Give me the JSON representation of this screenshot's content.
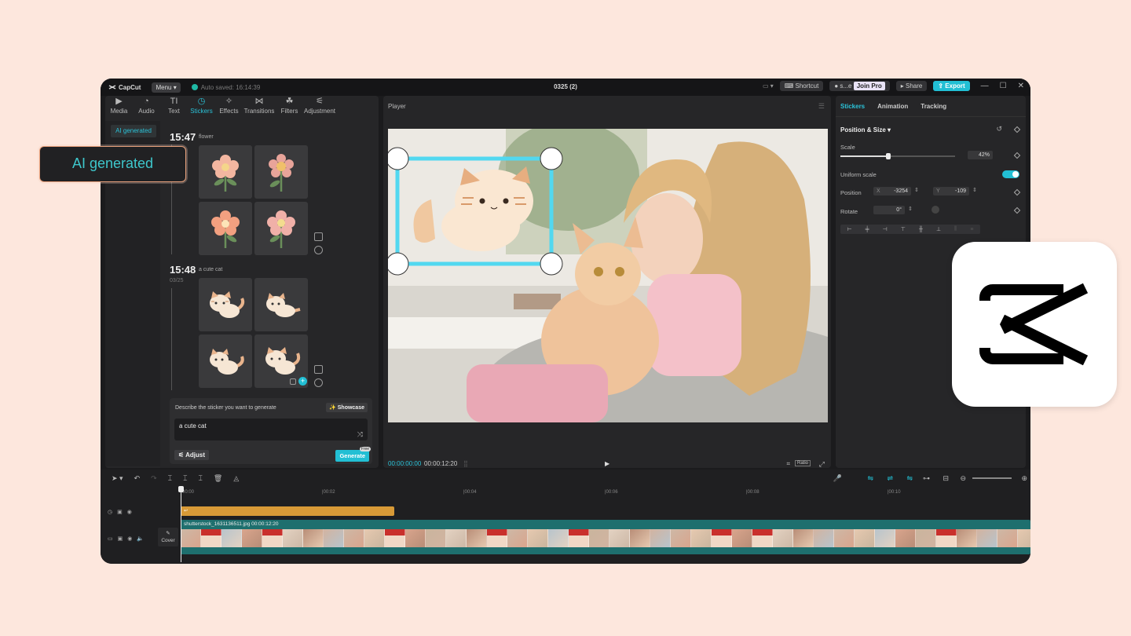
{
  "app": {
    "logo_text": "CapCut",
    "menu_label": "Menu",
    "auto_saved": "Auto saved: 16:14:39",
    "project_title": "0325 (2)",
    "shortcut_label": "Shortcut",
    "user_name": "s...e",
    "join_pro_label": "Join Pro",
    "share_label": "Share",
    "export_label": "Export"
  },
  "toolbar": {
    "tools": [
      {
        "label": "Media",
        "icon": "media-icon"
      },
      {
        "label": "Audio",
        "icon": "audio-icon"
      },
      {
        "label": "Text",
        "icon": "text-icon"
      },
      {
        "label": "Stickers",
        "icon": "stickers-icon"
      },
      {
        "label": "Effects",
        "icon": "effects-icon"
      },
      {
        "label": "Transitions",
        "icon": "transitions-icon"
      },
      {
        "label": "Filters",
        "icon": "filters-icon"
      },
      {
        "label": "Adjustment",
        "icon": "adjustment-icon"
      }
    ],
    "active": "Stickers"
  },
  "sidebar": {
    "items": [
      {
        "label": "AI generated"
      }
    ]
  },
  "results": {
    "groups": [
      {
        "time": "15:47",
        "prompt": "flower",
        "date": ""
      },
      {
        "time": "15:48",
        "prompt": "a cute cat",
        "date": "03/25"
      }
    ]
  },
  "prompt_box": {
    "label": "Describe the sticker you want to generate",
    "showcase_label": "Showcase",
    "value": "a cute cat",
    "adjust_label": "Adjust",
    "generate_label": "Generate",
    "free_badge": "Free"
  },
  "player": {
    "title": "Player",
    "current_time": "00:00:00:00",
    "duration": "00:00:12:20",
    "ratio_label": "Ratio"
  },
  "inspector": {
    "tabs": [
      "Stickers",
      "Animation",
      "Tracking"
    ],
    "active_tab": "Stickers",
    "section_title": "Position & Size",
    "scale_label": "Scale",
    "scale_value": "42%",
    "scale_fraction": 0.42,
    "uniform_scale_label": "Uniform scale",
    "uniform_scale_on": true,
    "position_label": "Position",
    "pos_x_label": "X",
    "pos_x": "-3254",
    "pos_y_label": "Y",
    "pos_y": "-109",
    "rotate_label": "Rotate",
    "rotate_value": "0°"
  },
  "timeline": {
    "ruler": [
      "00:00",
      "|00:02",
      "|00:04",
      "|00:06",
      "|00:08",
      "|00:10"
    ],
    "video_clip_label": "shutterstock_1631136511.jpg  00:00:12:20",
    "cover_label": "Cover"
  },
  "overlay": {
    "ai_badge": "AI generated"
  },
  "colors": {
    "accent": "#22bfd4",
    "background": "#fde7dd",
    "sticker_clip": "#d89a37",
    "video_clip": "#1e6f6e",
    "badge_border": "#e8a17c"
  }
}
